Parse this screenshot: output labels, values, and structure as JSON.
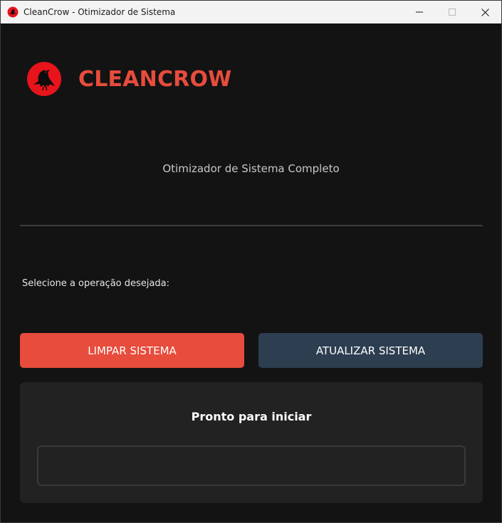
{
  "window": {
    "title": "CleanCrow - Otimizador de Sistema",
    "icon": "crow-logo-icon"
  },
  "header": {
    "brand": "CLEANCROW",
    "subtitle": "Otimizador de Sistema Completo"
  },
  "main": {
    "prompt": "Selecione a operação desejada:",
    "clean_label": "LIMPAR SISTEMA",
    "update_label": "ATUALIZAR SISTEMA"
  },
  "status": {
    "title": "Pronto para iniciar",
    "progress": 0
  },
  "colors": {
    "accent": "#e74c3c",
    "secondary": "#2c3e50",
    "background": "#131313",
    "panel": "#222222"
  }
}
